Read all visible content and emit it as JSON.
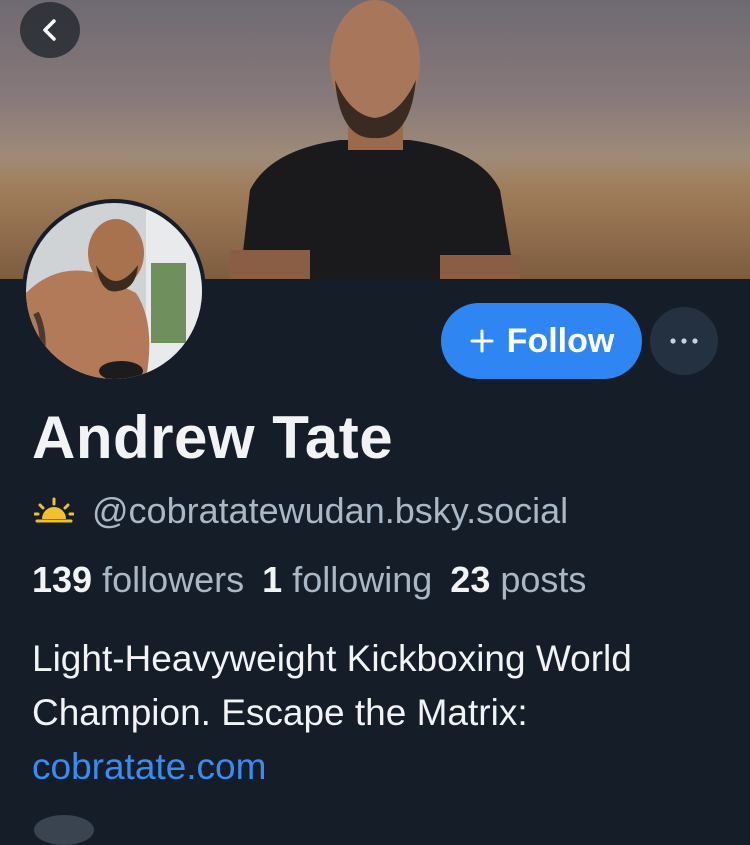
{
  "profile": {
    "display_name": "Andrew Tate",
    "handle": "@cobratatewudan.bsky.social",
    "followers_count": "139",
    "followers_label": "followers",
    "following_count": "1",
    "following_label": "following",
    "posts_count": "23",
    "posts_label": "posts",
    "bio_line1": "Light-Heavyweight Kickboxing World",
    "bio_line2": "Champion. Escape the Matrix:",
    "bio_link": "cobratate.com"
  },
  "actions": {
    "follow_label": "Follow"
  },
  "icons": {
    "back": "chevron-left-icon",
    "handle_badge": "sunrise-icon",
    "more": "ellipsis-icon",
    "follow_plus": "plus-icon"
  },
  "colors": {
    "background": "#151d28",
    "accent": "#2f86f2",
    "link": "#3a8cf2",
    "muted_text": "#aab7c6"
  }
}
